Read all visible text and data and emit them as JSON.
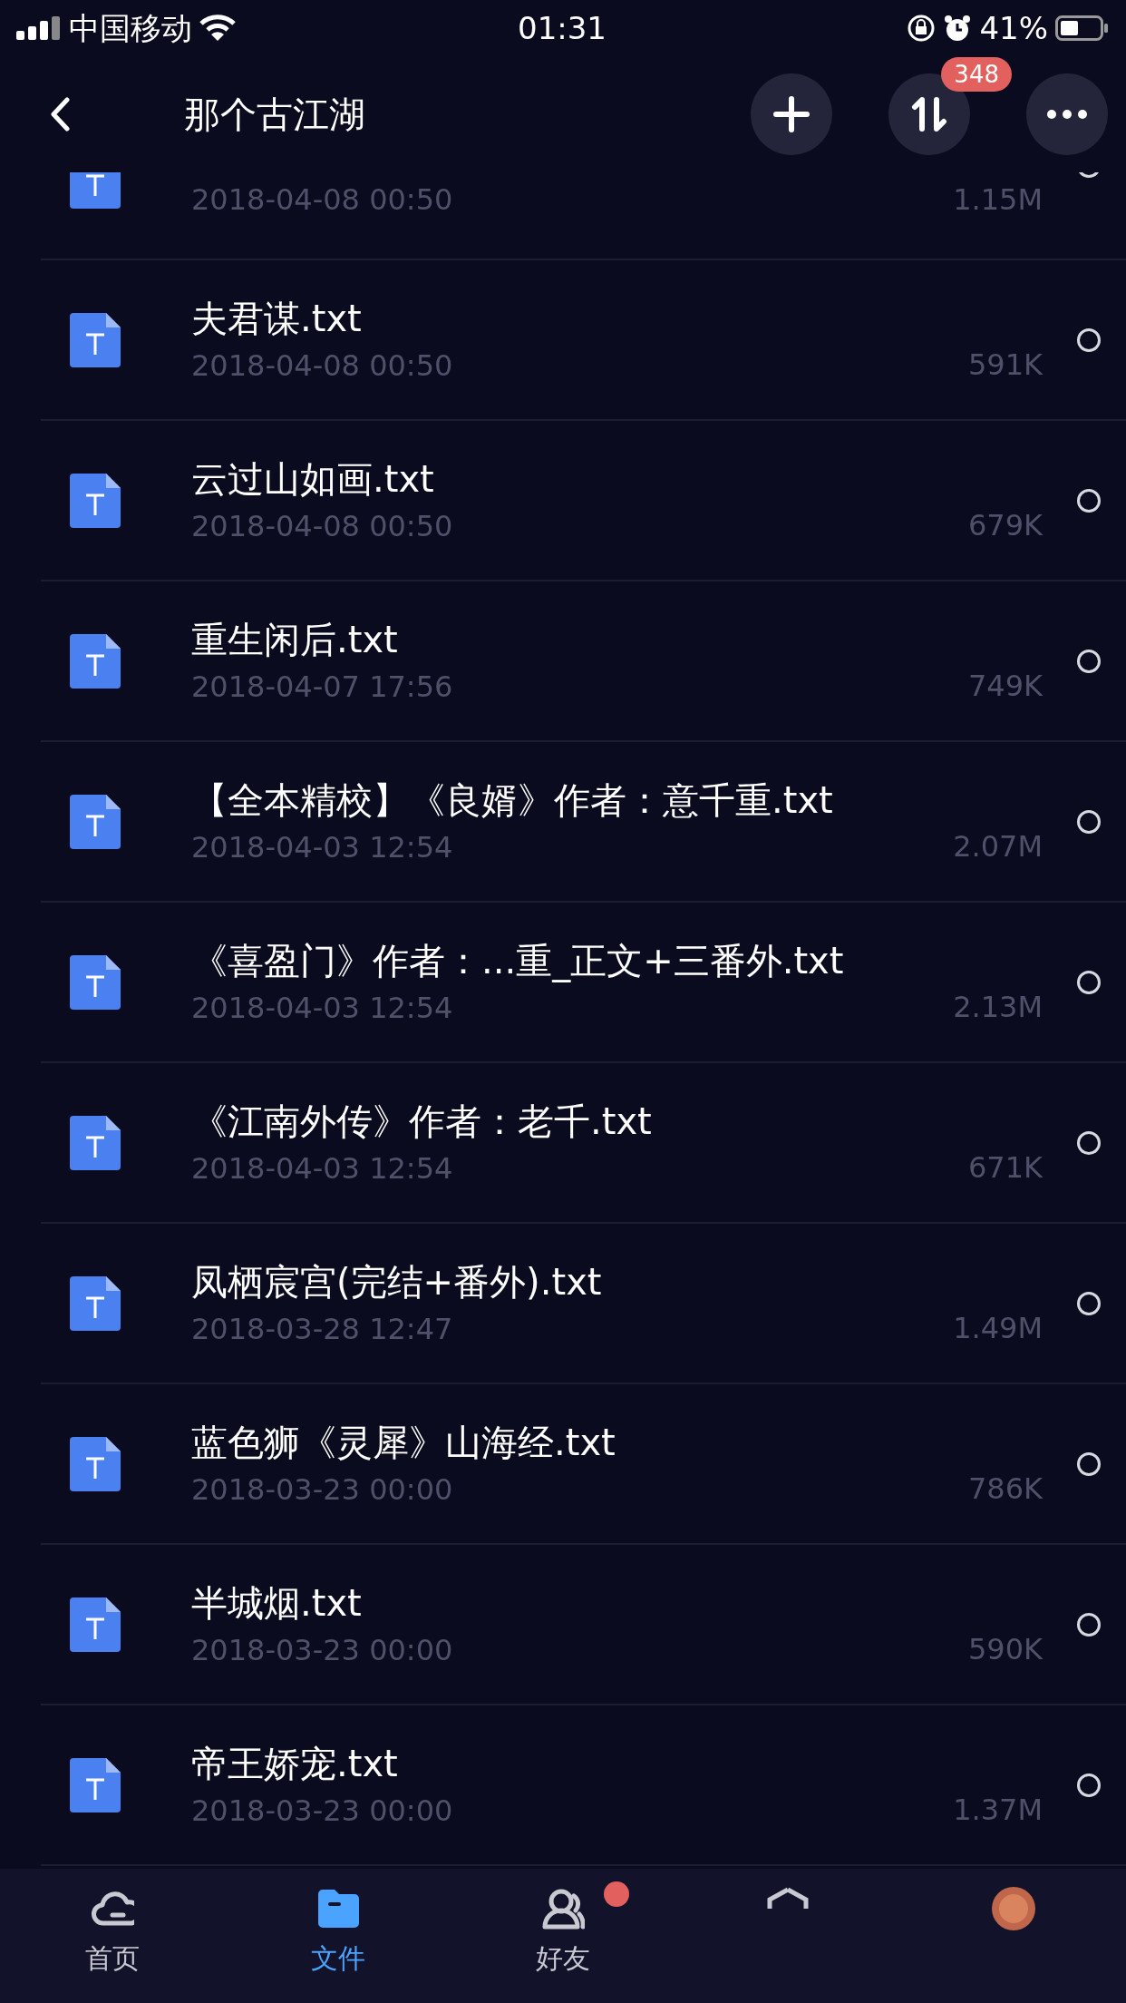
{
  "status_bar": {
    "carrier": "中国移动",
    "time": "01:31",
    "battery": "41%"
  },
  "header": {
    "title": "那个古江湖",
    "transfer_badge": "348"
  },
  "files": [
    {
      "date": "2018-04-08 00:50",
      "size": "1.15M",
      "partial": true,
      "selected": false
    },
    {
      "name": "夫君谋.txt",
      "date": "2018-04-08 00:50",
      "size": "591K",
      "selected": false
    },
    {
      "name": "云过山如画.txt",
      "date": "2018-04-08 00:50",
      "size": "679K",
      "selected": false
    },
    {
      "name": "重生闲后.txt",
      "date": "2018-04-07 17:56",
      "size": "749K",
      "selected": false
    },
    {
      "name": "【全本精校】《良婿》作者：意千重.txt",
      "date": "2018-04-03 12:54",
      "size": "2.07M",
      "selected": false
    },
    {
      "name": "《喜盈门》作者：...重_正文+三番外.txt",
      "date": "2018-04-03 12:54",
      "size": "2.13M",
      "selected": false
    },
    {
      "name": "《江南外传》作者：老千.txt",
      "date": "2018-04-03 12:54",
      "size": "671K",
      "selected": false
    },
    {
      "name": "凤栖宸宫(完结+番外).txt",
      "date": "2018-03-28 12:47",
      "size": "1.49M",
      "selected": false
    },
    {
      "name": "蓝色狮《灵犀》山海经.txt",
      "date": "2018-03-23 00:00",
      "size": "786K",
      "selected": false
    },
    {
      "name": "半城烟.txt",
      "date": "2018-03-23 00:00",
      "size": "590K",
      "selected": false
    },
    {
      "name": "帝王娇宠.txt",
      "date": "2018-03-23 00:00",
      "size": "1.37M",
      "selected": false
    }
  ],
  "tabs": [
    {
      "kind": "home",
      "label": "首页",
      "selected": false,
      "dot": false
    },
    {
      "kind": "files",
      "label": "文件",
      "selected": true,
      "dot": false
    },
    {
      "kind": "friends",
      "label": "好友",
      "selected": false,
      "dot": true
    },
    {
      "kind": "box",
      "selected": false,
      "dot": false
    },
    {
      "kind": "avatar",
      "selected": false,
      "dot": false
    }
  ]
}
